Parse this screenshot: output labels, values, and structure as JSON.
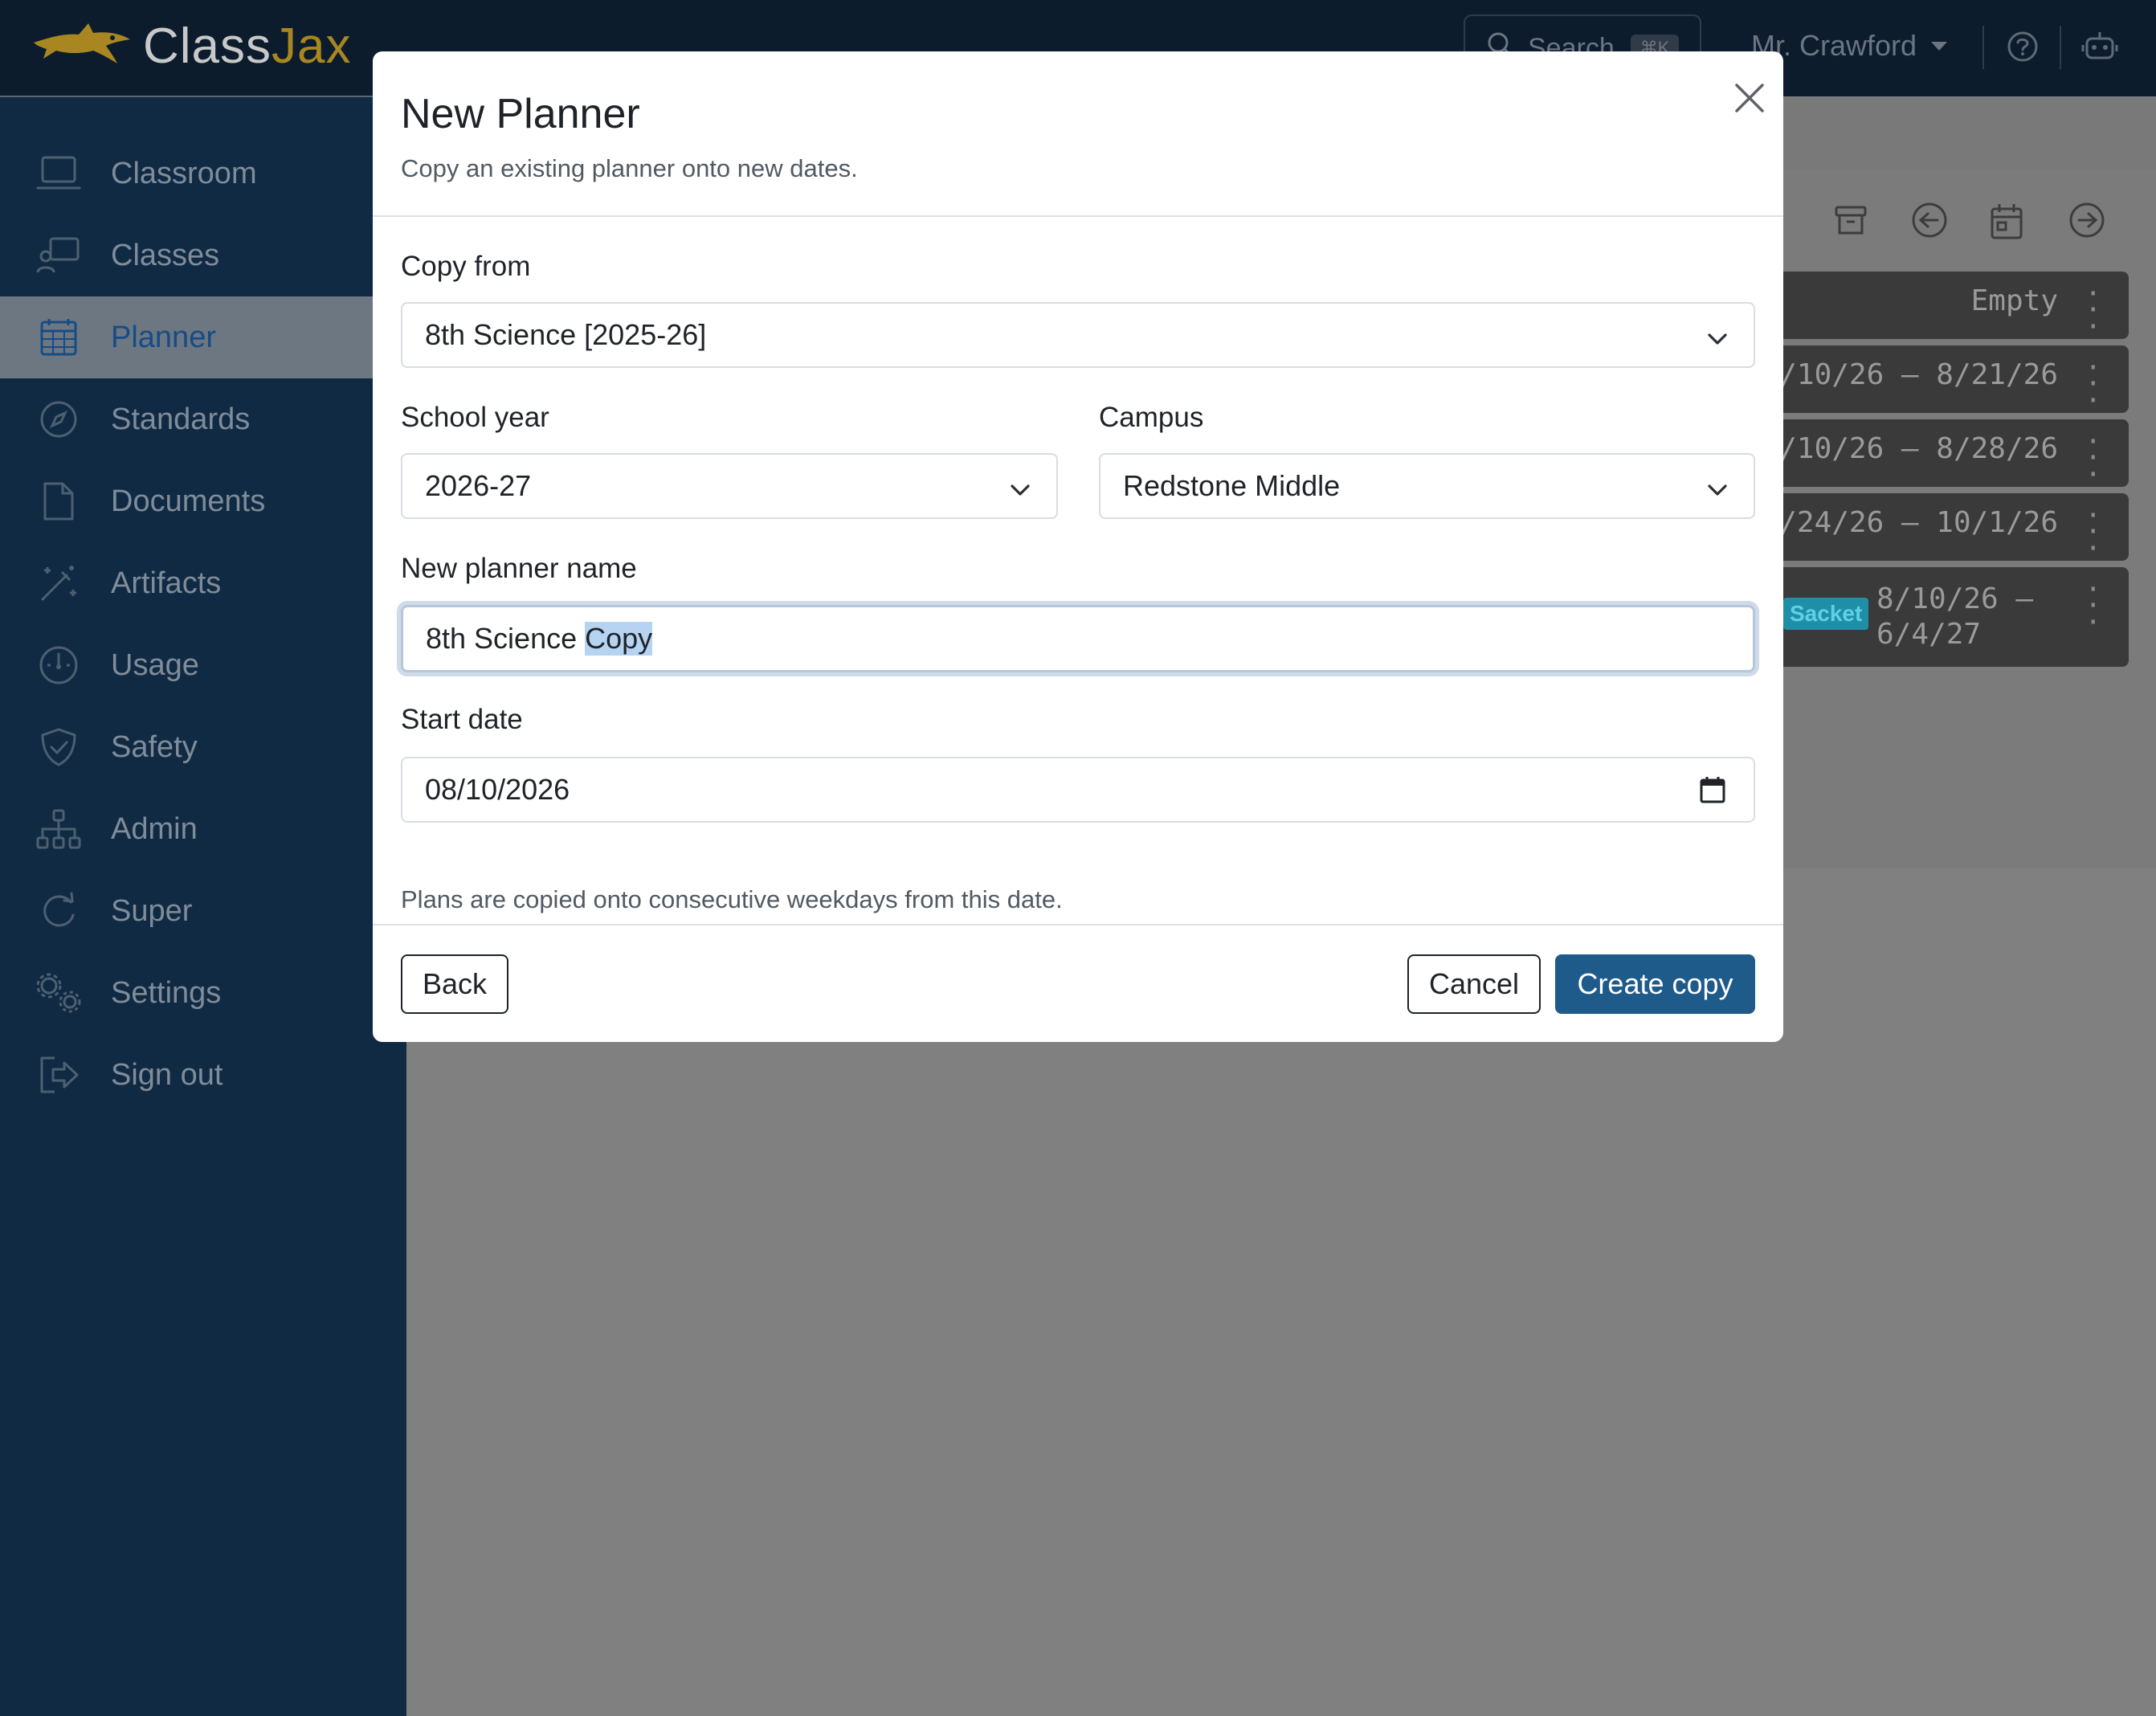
{
  "app": {
    "logo_class": "Class",
    "logo_jax": "Jax"
  },
  "topbar": {
    "search_placeholder": "Search",
    "search_shortcut": "⌘K",
    "user_name": "Mr. Crawford",
    "icons": [
      "help-icon",
      "robot-icon"
    ]
  },
  "sidebar": {
    "items": [
      {
        "label": "Classroom",
        "icon": "laptop-icon"
      },
      {
        "label": "Classes",
        "icon": "presenter-icon"
      },
      {
        "label": "Planner",
        "icon": "calendar-grid-icon",
        "active": true
      },
      {
        "label": "Standards",
        "icon": "compass-icon"
      },
      {
        "label": "Documents",
        "icon": "file-icon"
      },
      {
        "label": "Artifacts",
        "icon": "magic-wand-icon"
      },
      {
        "label": "Usage",
        "icon": "speedometer-icon"
      },
      {
        "label": "Safety",
        "icon": "shield-check-icon"
      },
      {
        "label": "Admin",
        "icon": "org-chart-icon"
      },
      {
        "label": "Super",
        "icon": "refresh-icon"
      },
      {
        "label": "Settings",
        "icon": "gears-icon"
      },
      {
        "label": "Sign out",
        "icon": "sign-out-icon"
      }
    ],
    "collapse_icon": "chevron-left-icon"
  },
  "background": {
    "rows": [
      {
        "text": "Empty"
      },
      {
        "text": "/10/26 – 8/21/26"
      },
      {
        "text": "/10/26 – 8/28/26"
      },
      {
        "text": "/24/26 – 10/1/26"
      },
      {
        "badge": "Sacket",
        "line1": "8/10/26 –",
        "line2": "6/4/27"
      }
    ]
  },
  "modal": {
    "title": "New Planner",
    "subtitle": "Copy an existing planner onto new dates.",
    "copy_from": {
      "label": "Copy from",
      "value": "8th Science [2025-26]"
    },
    "school_year": {
      "label": "School year",
      "value": "2026-27"
    },
    "campus": {
      "label": "Campus",
      "value": "Redstone Middle"
    },
    "planner_name": {
      "label": "New planner name",
      "value_unselected": "8th Science",
      "value_selected": "Copy"
    },
    "start_date": {
      "label": "Start date",
      "value": "08/10/2026",
      "help": "Plans are copied onto consecutive weekdays from this date."
    },
    "buttons": {
      "back": "Back",
      "cancel": "Cancel",
      "create": "Create copy"
    }
  },
  "colors": {
    "sidebar_bg": "#112a43",
    "topbar_bg": "#0c1c2d",
    "primary": "#1e5a8a",
    "logo_gold": "#a98720",
    "overlay": "#808080"
  }
}
